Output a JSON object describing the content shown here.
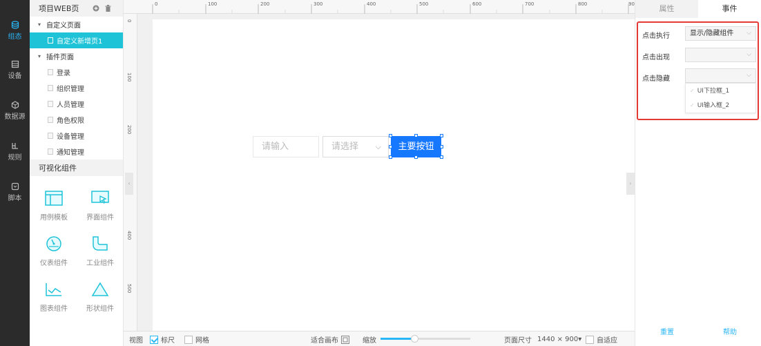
{
  "rail": {
    "items": [
      {
        "label": "组态",
        "icon": "database-icon",
        "active": true
      },
      {
        "label": "设备",
        "icon": "device-icon",
        "active": false
      },
      {
        "label": "数据源",
        "icon": "cube-icon",
        "active": false
      },
      {
        "label": "规则",
        "icon": "rule-icon",
        "active": false
      },
      {
        "label": "脚本",
        "icon": "script-icon",
        "active": false
      }
    ]
  },
  "left_panel": {
    "title": "项目WEB页",
    "tree": {
      "group1": "自定义页面",
      "group1_items": [
        "自定义新增页1"
      ],
      "group2": "插件页面",
      "group2_items": [
        "登录",
        "组织管理",
        "人员管理",
        "角色权限",
        "设备管理",
        "通知管理"
      ]
    },
    "components_title": "可视化组件",
    "components": [
      "用例模板",
      "界面组件",
      "仪表组件",
      "工业组件",
      "图表组件",
      "形状组件"
    ]
  },
  "ruler": {
    "top": [
      "0",
      "100",
      "200",
      "300",
      "400",
      "500",
      "600",
      "700",
      "800",
      "90"
    ],
    "left": [
      "0",
      "100",
      "200",
      "300",
      "400",
      "500"
    ]
  },
  "canvas": {
    "input_placeholder": "请输入",
    "select_placeholder": "请选择",
    "button_label": "主要按钮"
  },
  "bottom_bar": {
    "view_label": "视图",
    "ruler_label": "标尺",
    "ruler_checked": true,
    "grid_label": "网格",
    "grid_checked": false,
    "fit_label": "适合画布",
    "zoom_label": "缩放",
    "zoom_level": 0.38,
    "page_size_label": "页面尺寸",
    "page_size_value": "1440 × 900▾",
    "auto_label": "自适应",
    "auto_checked": false
  },
  "right_panel": {
    "tabs": [
      "属性",
      "事件"
    ],
    "active_tab": 1,
    "events": {
      "click_exec_label": "点击执行",
      "click_exec_value": "显示/隐藏组件",
      "click_show_label": "点击出现",
      "click_show_value": "",
      "click_hide_label": "点击隐藏",
      "click_hide_value": "",
      "hide_options": [
        "UI下拉框_1",
        "UI输入框_2"
      ]
    },
    "reset_label": "重置",
    "help_label": "帮助"
  },
  "colors": {
    "accent": "#29b6f6",
    "selected_row": "#1ec3d8",
    "primary_button": "#1677ff",
    "highlight_border": "#e53935",
    "rail_bg": "#2b2b2b"
  }
}
